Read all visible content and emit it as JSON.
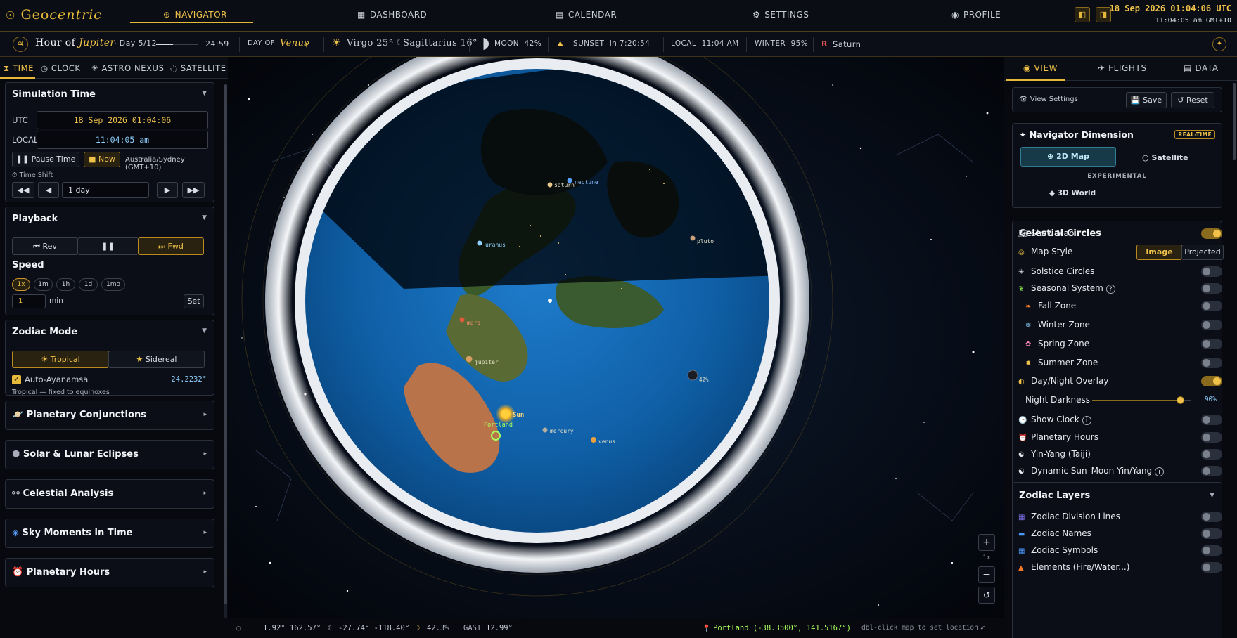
{
  "app": {
    "logo_prefix": "Geo",
    "logo_suffix": "centric"
  },
  "nav": {
    "tabs": [
      {
        "label": "NAVIGATOR",
        "icon": "⊕"
      },
      {
        "label": "DASHBOARD",
        "icon": "▦"
      },
      {
        "label": "CALENDAR",
        "icon": "▤"
      },
      {
        "label": "SETTINGS",
        "icon": "⚙"
      },
      {
        "label": "PROFILE",
        "icon": "◉"
      }
    ],
    "datetime_utc": "18 Sep 2026 01:04:06 UTC",
    "datetime_local": "11:04:05 am GMT+10"
  },
  "infobar": {
    "hour_prefix": "Hour of",
    "hour_planet": "Jupiter",
    "day_count": "· Day 5/12",
    "hour_countdown": "24:59",
    "day_of_label": "DAY OF",
    "day_of_planet": "Venus",
    "sun_sign": "Virgo 25°",
    "moon_sign": "Sagittarius 16°",
    "moon_label": "MOON",
    "moon_pct": "42%",
    "sunset_label": "SUNSET",
    "sunset_value": "in 7:20:54",
    "local_label": "LOCAL",
    "local_value": "11:04 AM",
    "season_label": "WINTER",
    "season_pct": "95%",
    "retro_symbol": "R",
    "retro_planet": "Saturn"
  },
  "left_tabs": [
    "TIME",
    "CLOCK",
    "ASTRO NEXUS",
    "SATELLITE"
  ],
  "sim_time": {
    "title": "Simulation Time",
    "utc_label": "UTC",
    "utc_value": "18 Sep 2026 01:04:06",
    "local_label": "LOCAL",
    "local_value": "11:04:05 am",
    "pause_label": "Pause Time",
    "now_label": "Now",
    "timezone": "Australia/Sydney (GMT+10)",
    "shift_label": "Time Shift",
    "shift_value": "1 day"
  },
  "playback": {
    "title": "Playback",
    "rev_label": "Rev",
    "fwd_label": "Fwd",
    "speed_label": "Speed",
    "speed_options": [
      "1x",
      "1m",
      "1h",
      "1d",
      "1mo"
    ],
    "speed_value": "1",
    "speed_unit": "min",
    "set_label": "Set"
  },
  "zodiac": {
    "title": "Zodiac Mode",
    "tropical_label": "Tropical",
    "sidereal_label": "Sidereal",
    "ayanamsa_label": "Auto-Ayanamsa",
    "ayanamsa_value": "24.2232°",
    "note": "Tropical — fixed to equinoxes"
  },
  "collapsed_sections": [
    "Planetary Conjunctions",
    "Solar & Lunar Eclipses",
    "Celestial Analysis",
    "Sky Moments in Time",
    "Planetary Hours"
  ],
  "map": {
    "planets": [
      {
        "name": "saturn"
      },
      {
        "name": "neptune"
      },
      {
        "name": "uranus"
      },
      {
        "name": "pluto"
      },
      {
        "name": "mars"
      },
      {
        "name": "jupiter"
      },
      {
        "name": "Sun"
      },
      {
        "name": "mercury"
      },
      {
        "name": "venus"
      }
    ],
    "moon_pct": "42%",
    "location_label": "Portland",
    "zoom_level": "1x"
  },
  "status": {
    "sun_coords": "1.92° 162.57°",
    "moon_coords": "-27.74° -118.40°",
    "moon_phase": "42.3%",
    "gast_label": "GAST",
    "gast_value": "12.99°",
    "location": "Portland (-38.3500°, 141.5167°)",
    "hint": "dbl-click map to set location"
  },
  "right_tabs": [
    "VIEW",
    "FLIGHTS",
    "DATA"
  ],
  "view_settings": {
    "label": "View Settings",
    "save": "Save",
    "reset": "Reset"
  },
  "dimension": {
    "title": "Navigator Dimension",
    "badge": "REAL-TIME",
    "map2d": "2D Map",
    "satellite": "Satellite",
    "experimental": "EXPERIMENTAL",
    "world3d": "3D World"
  },
  "celestial": {
    "title": "Celestial Circles",
    "show_map": "Show Map",
    "map_style": "Map Style",
    "style_image": "Image",
    "style_projected": "Projected",
    "solstice": "Solstice Circles",
    "seasonal": "Seasonal System",
    "fall": "Fall Zone",
    "winter": "Winter Zone",
    "spring": "Spring Zone",
    "summer": "Summer Zone",
    "daynight": "Day/Night Overlay",
    "night_darkness": "Night Darkness",
    "night_value": "90%",
    "night_level": 0.9,
    "show_clock": "Show Clock",
    "planetary_hours": "Planetary Hours",
    "yinyang": "Yin-Yang (Taiji)",
    "dynamic": "Dynamic Sun–Moon Yin/Yang"
  },
  "zodiac_layers": {
    "title": "Zodiac Layers",
    "division": "Zodiac Division Lines",
    "names": "Zodiac Names",
    "symbols": "Zodiac Symbols",
    "elements": "Elements (Fire/Water...)"
  },
  "colors": {
    "accent": "#e7b93a",
    "ocean": "#0f5fa6",
    "toggle_on": "#f0c24a"
  }
}
